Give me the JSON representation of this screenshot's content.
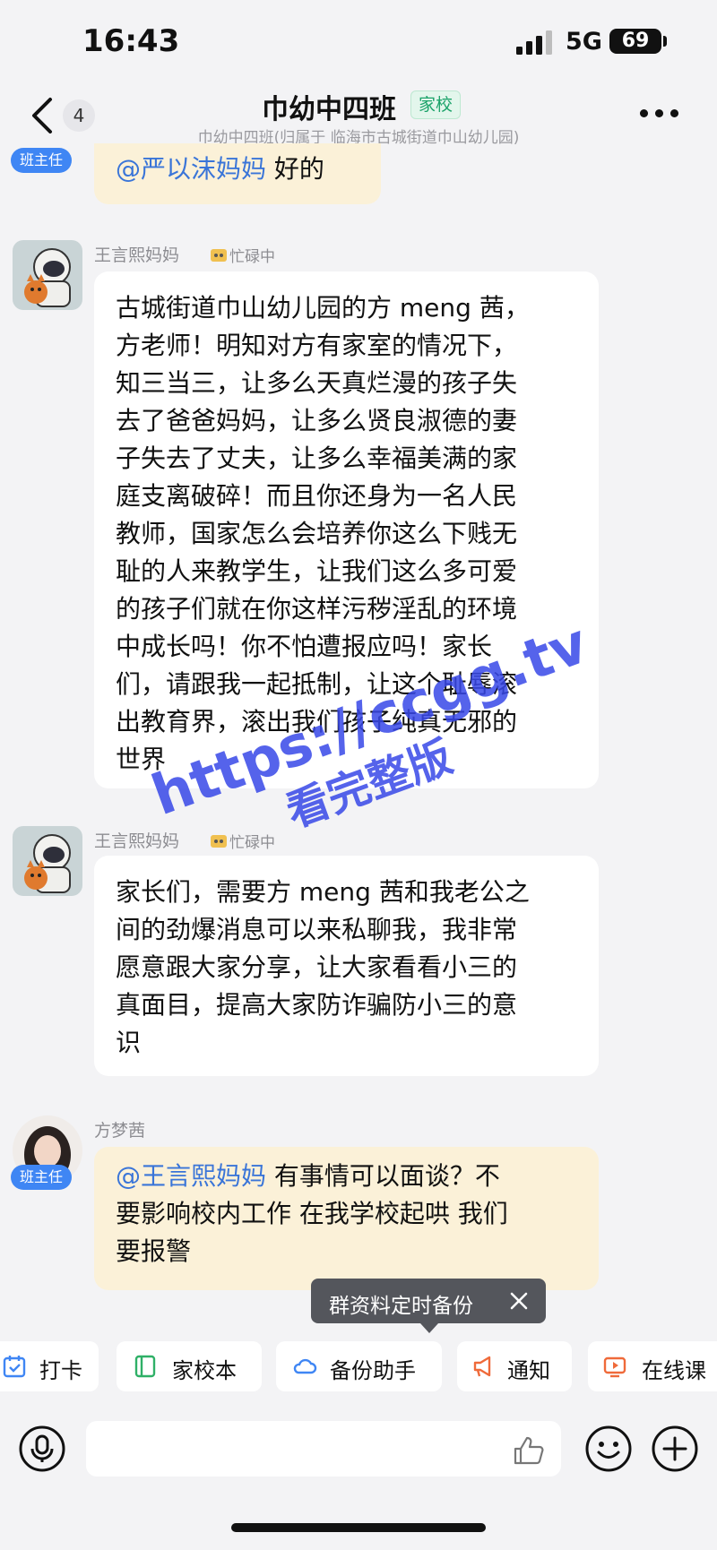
{
  "status_bar": {
    "time": "16:43",
    "network": "5G",
    "battery": "69"
  },
  "header": {
    "unread_count": "4",
    "title": "巾幼中四班",
    "tag": "家校",
    "subtitle": "巾幼中四班(归属于 临海市古城街道巾山幼儿园)"
  },
  "messages": [
    {
      "role_badge": "班主任",
      "mention": "@严以沫妈妈",
      "text": " 好的"
    },
    {
      "sender": "王言熙妈妈",
      "status": "忙碌中",
      "lines": [
        "古城街道巾山幼儿园的方 meng 茜，",
        "方老师！明知对方有家室的情况下，",
        "知三当三，让多么天真烂漫的孩子失",
        "去了爸爸妈妈，让多么贤良淑德的妻",
        "子失去了丈夫，让多么幸福美满的家",
        "庭支离破碎！而且你还身为一名人民",
        "教师，国家怎么会培养你这么下贱无",
        "耻的人来教学生，让我们这么多可爱",
        "的孩子们就在你这样污秽淫乱的环境",
        "中成长吗！你不怕遭报应吗！家长",
        "们，请跟我一起抵制，让这个耻辱滚",
        "出教育界，滚出我们孩子纯真无邪的",
        "世界"
      ]
    },
    {
      "sender": "王言熙妈妈",
      "status": "忙碌中",
      "lines": [
        "家长们，需要方 meng 茜和我老公之",
        "间的劲爆消息可以来私聊我，我非常",
        "愿意跟大家分享，让大家看看小三的",
        "真面目，提高大家防诈骗防小三的意",
        "识"
      ]
    },
    {
      "sender": "方梦茜",
      "role_badge": "班主任",
      "mention": "@王言熙妈妈",
      "lines": [
        " 有事情可以面谈？不",
        "要影响校内工作  在我学校起哄  我们",
        "要报警"
      ]
    }
  ],
  "watermark": {
    "url": "https://ccgg.tv",
    "subtitle": "看完整版"
  },
  "tooltip": {
    "text": "群资料定时备份"
  },
  "toolbar": {
    "items": [
      {
        "label": "打卡",
        "icon": "calendar-check-icon"
      },
      {
        "label": "家校本",
        "icon": "notebook-icon"
      },
      {
        "label": "备份助手",
        "icon": "cloud-icon"
      },
      {
        "label": "通知",
        "icon": "megaphone-icon"
      },
      {
        "label": "在线课",
        "icon": "video-lesson-icon"
      }
    ]
  },
  "input_bar": {
    "placeholder": ""
  },
  "colors": {
    "accent_blue": "#3f86f4",
    "mention_blue": "#3a75d8",
    "tag_green": "#1ca36a",
    "teacher_bubble": "#fbf1d8"
  }
}
